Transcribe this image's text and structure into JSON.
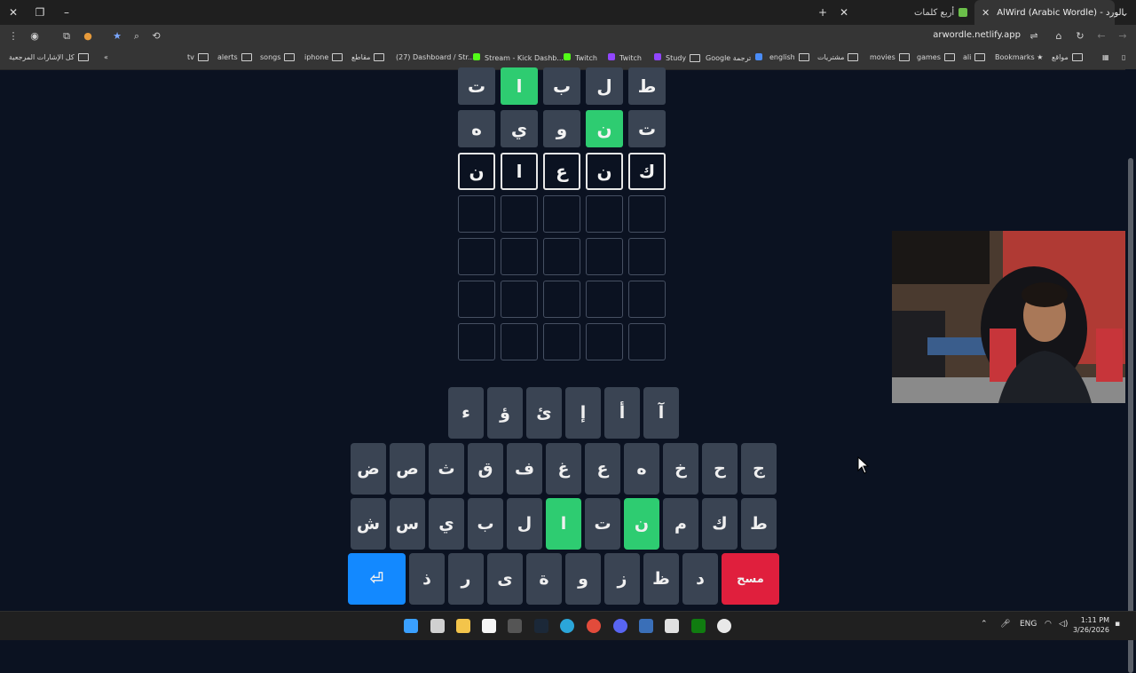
{
  "browser": {
    "tabs": [
      {
        "title": "أربع كلمات",
        "active": false
      },
      {
        "title": "AlWird (Arabic Wordle) - الورد",
        "active": true
      }
    ],
    "url": "arwordle.netlify.app",
    "bookmarks": [
      "كل الإشارات المرجعية",
      "tv",
      "alerts",
      "songs",
      "iphone",
      "مقاطع",
      "(27) Dashboard / Str...",
      "Stream - Kick Dashb...",
      "Twitch",
      "Twitch",
      "Study",
      "Google ترجمة",
      "english",
      "مشتريات",
      "movies",
      "games",
      "ali",
      "Bookmarks",
      "مواقع"
    ]
  },
  "board": {
    "rows": [
      {
        "letters": [
          "ط",
          "ل",
          "ب",
          "ا",
          "ت"
        ],
        "states": [
          "absent",
          "absent",
          "absent",
          "correct",
          "absent"
        ]
      },
      {
        "letters": [
          "ت",
          "ن",
          "و",
          "ي",
          "ه"
        ],
        "states": [
          "absent",
          "correct",
          "absent",
          "absent",
          "absent"
        ]
      },
      {
        "letters": [
          "ك",
          "ن",
          "ع",
          "ا",
          "ن"
        ],
        "states": [
          "typed",
          "typed",
          "typed",
          "typed",
          "typed"
        ]
      },
      {
        "letters": [
          "",
          "",
          "",
          "",
          ""
        ],
        "states": [
          "empty",
          "empty",
          "empty",
          "empty",
          "empty"
        ]
      },
      {
        "letters": [
          "",
          "",
          "",
          "",
          ""
        ],
        "states": [
          "empty",
          "empty",
          "empty",
          "empty",
          "empty"
        ]
      },
      {
        "letters": [
          "",
          "",
          "",
          "",
          ""
        ],
        "states": [
          "empty",
          "empty",
          "empty",
          "empty",
          "empty"
        ]
      },
      {
        "letters": [
          "",
          "",
          "",
          "",
          ""
        ],
        "states": [
          "empty",
          "empty",
          "empty",
          "empty",
          "empty"
        ]
      }
    ]
  },
  "keyboard": {
    "row1": [
      {
        "label": "آ"
      },
      {
        "label": "أ"
      },
      {
        "label": "إ"
      },
      {
        "label": "ئ"
      },
      {
        "label": "ؤ"
      },
      {
        "label": "ء"
      }
    ],
    "row2": [
      {
        "label": "ج"
      },
      {
        "label": "ح"
      },
      {
        "label": "خ"
      },
      {
        "label": "ه"
      },
      {
        "label": "ع"
      },
      {
        "label": "غ"
      },
      {
        "label": "ف"
      },
      {
        "label": "ق"
      },
      {
        "label": "ث"
      },
      {
        "label": "ص"
      },
      {
        "label": "ض"
      }
    ],
    "row3": [
      {
        "label": "ط",
        "state": "absent"
      },
      {
        "label": "ك",
        "state": "absent"
      },
      {
        "label": "م",
        "state": "normal"
      },
      {
        "label": "ن",
        "state": "correct"
      },
      {
        "label": "ت",
        "state": "absent"
      },
      {
        "label": "ا",
        "state": "correct"
      },
      {
        "label": "ل",
        "state": "absent"
      },
      {
        "label": "ب",
        "state": "absent"
      },
      {
        "label": "ي",
        "state": "absent"
      },
      {
        "label": "س",
        "state": "normal"
      },
      {
        "label": "ش",
        "state": "normal"
      }
    ],
    "row4": [
      {
        "label": "مسح",
        "kind": "delete"
      },
      {
        "label": "د"
      },
      {
        "label": "ظ"
      },
      {
        "label": "ز"
      },
      {
        "label": "و"
      },
      {
        "label": "ة"
      },
      {
        "label": "ى"
      },
      {
        "label": "ر"
      },
      {
        "label": "ذ"
      },
      {
        "label": "⏎",
        "kind": "enter"
      }
    ]
  },
  "colors": {
    "correct": "#2ecc71",
    "absent": "#3a4453",
    "enter": "#1389ff",
    "delete": "#e01f3d",
    "background": "#0b1221"
  },
  "taskbar": {
    "lang": "ENG",
    "time": "1:11 PM",
    "date": "3/26/2026"
  }
}
